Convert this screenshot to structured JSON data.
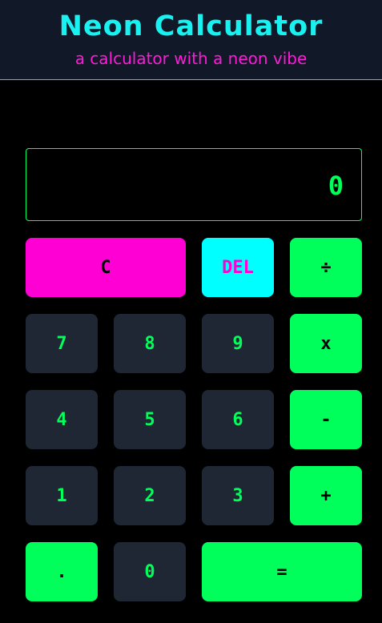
{
  "header": {
    "title": "Neon Calculator",
    "subtitle": "a calculator with a neon vibe"
  },
  "display": {
    "value": "0"
  },
  "buttons": {
    "clear": "C",
    "del": "DEL",
    "divide": "÷",
    "seven": "7",
    "eight": "8",
    "nine": "9",
    "multiply": "x",
    "four": "4",
    "five": "5",
    "six": "6",
    "subtract": "-",
    "one": "1",
    "two": "2",
    "three": "3",
    "add": "+",
    "decimal": ".",
    "zero": "0",
    "equals": "="
  },
  "colors": {
    "title": "#19f0f0",
    "subtitle": "#ff1ad9",
    "neon_green": "#00ff5a",
    "neon_cyan": "#00ffff",
    "neon_magenta": "#ff00d4",
    "number_key_bg": "#1e2733",
    "header_bg": "#111827"
  }
}
